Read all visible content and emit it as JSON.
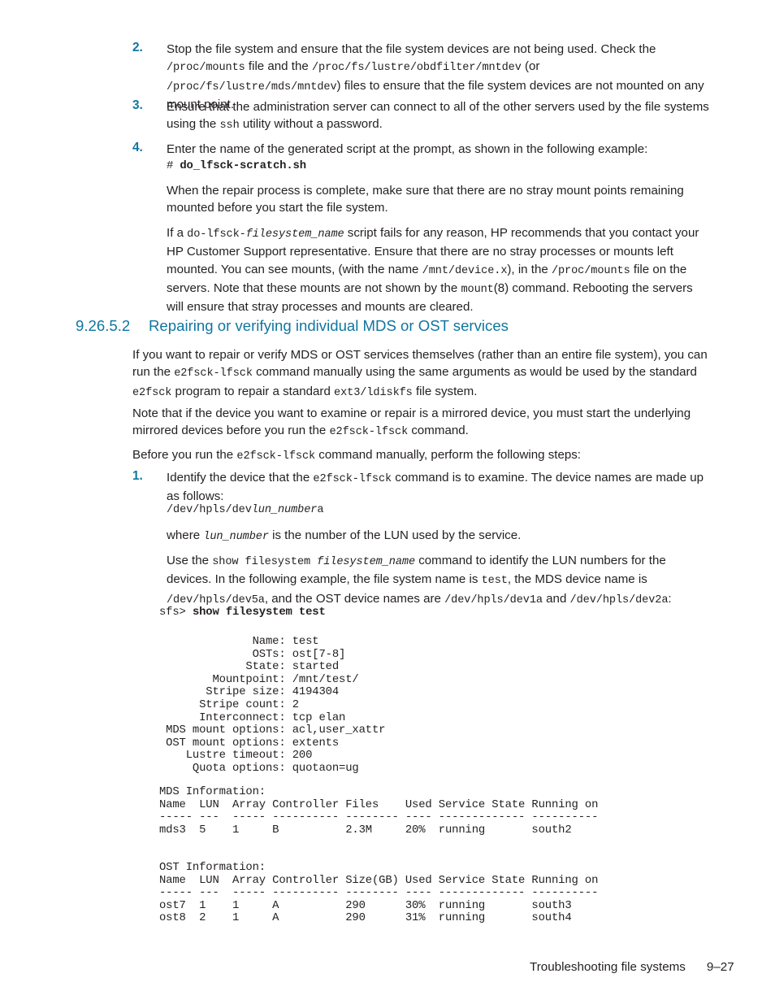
{
  "page": {
    "footer_section": "Troubleshooting file systems",
    "footer_page": "9–27",
    "accent_color": "#1076a0",
    "text_color": "#231f20"
  },
  "steps_top": [
    {
      "number": "2.",
      "segments": [
        {
          "t": "Stop the file system and ensure that the file system devices are not being used. Check the ",
          "s": "normal"
        },
        {
          "t": "/proc/mounts",
          "s": "mono"
        },
        {
          "t": " file and the ",
          "s": "normal"
        },
        {
          "t": "/proc/fs/lustre/obdfilter/mntdev",
          "s": "mono"
        },
        {
          "t": " (or ",
          "s": "normal"
        },
        {
          "t": "/proc/fs/lustre/mds/mntdev",
          "s": "mono"
        },
        {
          "t": ") files to ensure that the file system devices are not mounted on any mount point.",
          "s": "normal"
        }
      ]
    },
    {
      "number": "3.",
      "segments": [
        {
          "t": "Ensure that the administration server can connect to all of the other servers used by the file systems using the ",
          "s": "normal"
        },
        {
          "t": "ssh",
          "s": "mono"
        },
        {
          "t": " utility without a password.",
          "s": "normal"
        }
      ]
    },
    {
      "number": "4.",
      "segments": [
        {
          "t": "Enter the name of the generated script at the prompt, as shown in the following example:",
          "s": "normal"
        }
      ]
    }
  ],
  "step4_command": {
    "prompt": "# ",
    "command": "do_lfsck-scratch.sh"
  },
  "para_repair_complete": [
    {
      "t": "When the repair process is complete, make sure that there are no stray mount points remaining mounted before you start the file system.",
      "s": "normal"
    }
  ],
  "para_if_script_fails": [
    {
      "t": "If a ",
      "s": "normal"
    },
    {
      "t": "do-lfsck-",
      "s": "mono"
    },
    {
      "t": "filesystem_name",
      "s": "mono-i"
    },
    {
      "t": " script fails for any reason, HP recommends that you contact your HP Customer Support representative. Ensure that there are no stray processes or mounts left mounted. You can see mounts, (with the name ",
      "s": "normal"
    },
    {
      "t": "/mnt/device.x",
      "s": "mono"
    },
    {
      "t": "), in the ",
      "s": "normal"
    },
    {
      "t": "/proc/mounts",
      "s": "mono"
    },
    {
      "t": " file on the servers. Note that these mounts are not shown by the ",
      "s": "normal"
    },
    {
      "t": "mount",
      "s": "mono"
    },
    {
      "t": "(8) command. Rebooting the servers will ensure that stray processes and mounts are cleared.",
      "s": "normal"
    }
  ],
  "heading": {
    "number": "9.26.5.2",
    "title": "Repairing or verifying individual MDS or OST services"
  },
  "para_if_you_want": [
    {
      "t": "If you want to repair or verify MDS or OST services themselves (rather than an entire file system), you can run the ",
      "s": "normal"
    },
    {
      "t": "e2fsck-lfsck",
      "s": "mono"
    },
    {
      "t": " command manually using the same arguments as would be used by the standard ",
      "s": "normal"
    },
    {
      "t": "e2fsck",
      "s": "mono"
    },
    {
      "t": " program to repair a standard ",
      "s": "normal"
    },
    {
      "t": "ext3/ldiskfs",
      "s": "mono"
    },
    {
      "t": " file system.",
      "s": "normal"
    }
  ],
  "para_note_mirrored": [
    {
      "t": "Note that if the device you want to examine or repair is a mirrored device, you must start the underlying mirrored devices before you run the ",
      "s": "normal"
    },
    {
      "t": "e2fsck-lfsck",
      "s": "mono"
    },
    {
      "t": " command.",
      "s": "normal"
    }
  ],
  "para_before_you_run": [
    {
      "t": "Before you run the ",
      "s": "normal"
    },
    {
      "t": "e2fsck-lfsck",
      "s": "mono"
    },
    {
      "t": " command manually, perform the following steps:",
      "s": "normal"
    }
  ],
  "step1": {
    "number": "1.",
    "segments": [
      {
        "t": "Identify the device that the ",
        "s": "normal"
      },
      {
        "t": "e2fsck-lfsck",
        "s": "mono"
      },
      {
        "t": " command is to examine. The device names are made up as follows:",
        "s": "normal"
      }
    ]
  },
  "device_name_pattern": [
    {
      "t": "/dev/hpls/dev",
      "s": "mono"
    },
    {
      "t": "lun_number",
      "s": "mono-i"
    },
    {
      "t": "a",
      "s": "mono"
    }
  ],
  "para_where_lun": [
    {
      "t": "where ",
      "s": "normal"
    },
    {
      "t": "lun_number",
      "s": "mono-i"
    },
    {
      "t": " is the number of the LUN used by the service.",
      "s": "normal"
    }
  ],
  "para_use_show": [
    {
      "t": "Use the ",
      "s": "normal"
    },
    {
      "t": "show filesystem ",
      "s": "mono"
    },
    {
      "t": "filesystem_name",
      "s": "mono-i"
    },
    {
      "t": " command to identify the LUN numbers for the devices. In the following example, the file system name is ",
      "s": "normal"
    },
    {
      "t": "test",
      "s": "mono"
    },
    {
      "t": ", the MDS device name is ",
      "s": "normal"
    },
    {
      "t": "/dev/hpls/dev5a",
      "s": "mono"
    },
    {
      "t": ", and the OST device names are ",
      "s": "normal"
    },
    {
      "t": "/dev/hpls/dev1a",
      "s": "mono"
    },
    {
      "t": " and ",
      "s": "normal"
    },
    {
      "t": "/dev/hpls/dev2a",
      "s": "mono"
    },
    {
      "t": ":",
      "s": "normal"
    }
  ],
  "terminal": {
    "prompt": "sfs> ",
    "command": "show filesystem test",
    "properties": [
      {
        "label": "Name:",
        "value": "test"
      },
      {
        "label": "OSTs:",
        "value": "ost[7-8]"
      },
      {
        "label": "State:",
        "value": "started"
      },
      {
        "label": "Mountpoint:",
        "value": "/mnt/test/"
      },
      {
        "label": "Stripe size:",
        "value": "4194304"
      },
      {
        "label": "Stripe count:",
        "value": "2"
      },
      {
        "label": "Interconnect:",
        "value": "tcp elan"
      },
      {
        "label": "MDS mount options:",
        "value": "acl,user_xattr"
      },
      {
        "label": "OST mount options:",
        "value": "extents"
      },
      {
        "label": "Lustre timeout:",
        "value": "200"
      },
      {
        "label": "Quota options:",
        "value": "quotaon=ug"
      }
    ],
    "mds_section": {
      "title": "MDS Information:",
      "headers": [
        "Name",
        "LUN",
        "Array",
        "Controller",
        "Files",
        "Used",
        "Service State",
        "Running on"
      ],
      "rules": [
        "-----",
        "---",
        "-----",
        "----------",
        "--------",
        "----",
        "-------------",
        "----------"
      ],
      "rows": [
        [
          "mds3",
          "5",
          "1",
          "B",
          "2.3M",
          "20%",
          "running",
          "south2"
        ]
      ]
    },
    "ost_section": {
      "title": "OST Information:",
      "headers": [
        "Name",
        "LUN",
        "Array",
        "Controller",
        "Size(GB)",
        "Used",
        "Service State",
        "Running on"
      ],
      "rules": [
        "-----",
        "---",
        "-----",
        "----------",
        "--------",
        "----",
        "-------------",
        "----------"
      ],
      "rows": [
        [
          "ost7",
          "1",
          "1",
          "A",
          "290",
          "30%",
          "running",
          "south3"
        ],
        [
          "ost8",
          "2",
          "1",
          "A",
          "290",
          "31%",
          "running",
          "south4"
        ]
      ]
    }
  }
}
